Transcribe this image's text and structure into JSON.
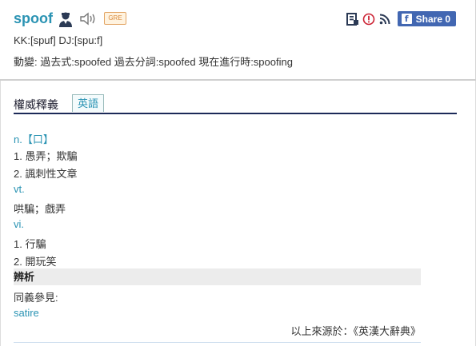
{
  "entry": {
    "word": "spoof",
    "badge": "GRE",
    "pronunciation": "KK:[spuf] DJ:[spu:f]",
    "inflection": "動變: 過去式:spoofed  過去分詞:spoofed  現在進行時:spoofing"
  },
  "share": {
    "label": "Share 0",
    "fb_glyph": "f"
  },
  "tabs": {
    "main": "權威釋義",
    "english": "英語"
  },
  "definitions": [
    {
      "text": "n.【口】",
      "kind": "pos"
    },
    {
      "text": "1. 愚弄；欺騙",
      "kind": "def"
    },
    {
      "text": "2. 諷刺性文章",
      "kind": "def"
    },
    {
      "text": "vt.",
      "kind": "pos"
    },
    {
      "text": "哄騙；戲弄",
      "kind": "def"
    },
    {
      "text": "vi.",
      "kind": "pos"
    },
    {
      "text": "1. 行騙",
      "kind": "def"
    },
    {
      "text": "2. 開玩笑",
      "kind": "def"
    }
  ],
  "analysis": {
    "heading": "辨析",
    "see_also_label": "同義參見:",
    "see_also_word": "satire"
  },
  "source": "以上來源於：《英漢大辭典》",
  "icons": {
    "person": "person-icon",
    "speaker": "speaker-icon",
    "save": "save-icon",
    "report": "report-icon",
    "rss": "rss-icon",
    "facebook": "facebook-icon"
  },
  "colors": {
    "accent": "#2a93b3",
    "navy_rule": "#1c2a58",
    "facebook": "#4267b2"
  }
}
